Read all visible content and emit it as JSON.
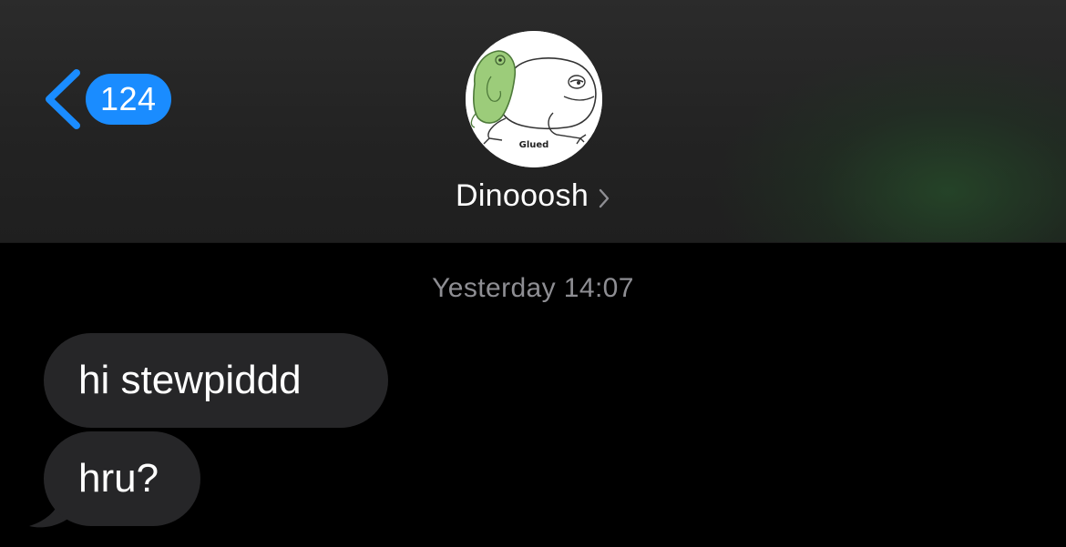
{
  "header": {
    "back": {
      "icon": "chevron-left-icon",
      "unread_count": "124",
      "accent_color": "#1a8cff"
    },
    "contact": {
      "name": "Dinooosh",
      "avatar_caption": "Glued",
      "disclosure_icon": "chevron-right-icon"
    }
  },
  "conversation": {
    "timestamp": "Yesterday 14:07",
    "messages": [
      {
        "direction": "incoming",
        "text": "hi stewpiddd"
      },
      {
        "direction": "incoming",
        "text": "hru?"
      }
    ],
    "bubble_color": "#262628"
  }
}
